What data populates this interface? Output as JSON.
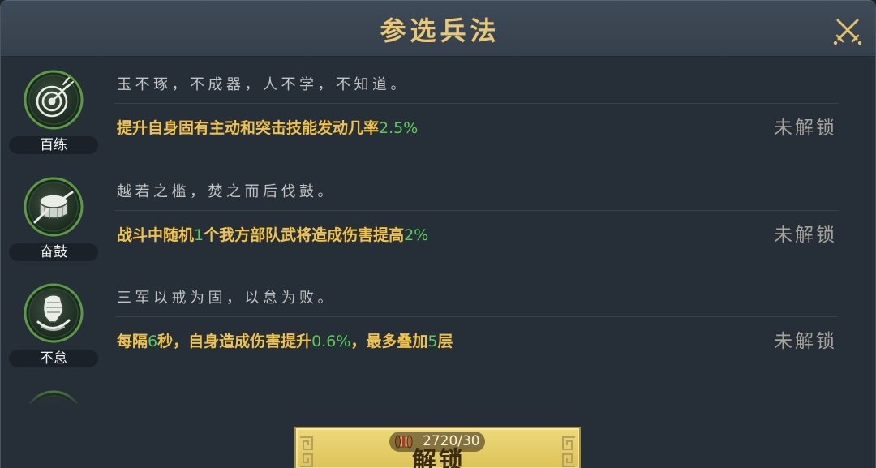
{
  "dialog": {
    "title": "参选兵法",
    "close_icon": "crossed-swords-close-icon"
  },
  "tactics": [
    {
      "name": "百练",
      "icon": "target-arrow-icon",
      "quote": "玉不琢，不成器，人不学，不知道。",
      "description": [
        {
          "text": "提升自身固有主动和突击技能发动几率",
          "highlight": false
        },
        {
          "text": "2.5%",
          "highlight": true
        }
      ],
      "status": "未解锁"
    },
    {
      "name": "奋鼓",
      "icon": "war-drum-icon",
      "quote": "越若之槛，焚之而后伐鼓。",
      "description": [
        {
          "text": "战斗中随机",
          "highlight": false
        },
        {
          "text": "1",
          "highlight": true
        },
        {
          "text": "个我方部队武将造成伤害提高",
          "highlight": false
        },
        {
          "text": "2%",
          "highlight": true
        }
      ],
      "status": "未解锁"
    },
    {
      "name": "不怠",
      "icon": "fist-swirl-icon",
      "quote": "三军以戒为固，以怠为败。",
      "description": [
        {
          "text": "每隔",
          "highlight": false
        },
        {
          "text": "6",
          "highlight": true
        },
        {
          "text": "秒，自身造成伤害提升",
          "highlight": false
        },
        {
          "text": "0.6%",
          "highlight": true
        },
        {
          "text": "，最多叠加",
          "highlight": false
        },
        {
          "text": "5",
          "highlight": true
        },
        {
          "text": "层",
          "highlight": false
        }
      ],
      "status": "未解锁"
    }
  ],
  "unlock_button": {
    "cost_icon": "scroll-icon",
    "cost": "2720/30",
    "label": "解锁"
  },
  "colors": {
    "title_gold": "#e8c878",
    "description_yellow": "#f0c24a",
    "value_green": "#5ccb5c",
    "status_gray": "#a7a39b",
    "icon_ring_green": "#5c9a45",
    "button_yellow": "#e6cd67"
  }
}
